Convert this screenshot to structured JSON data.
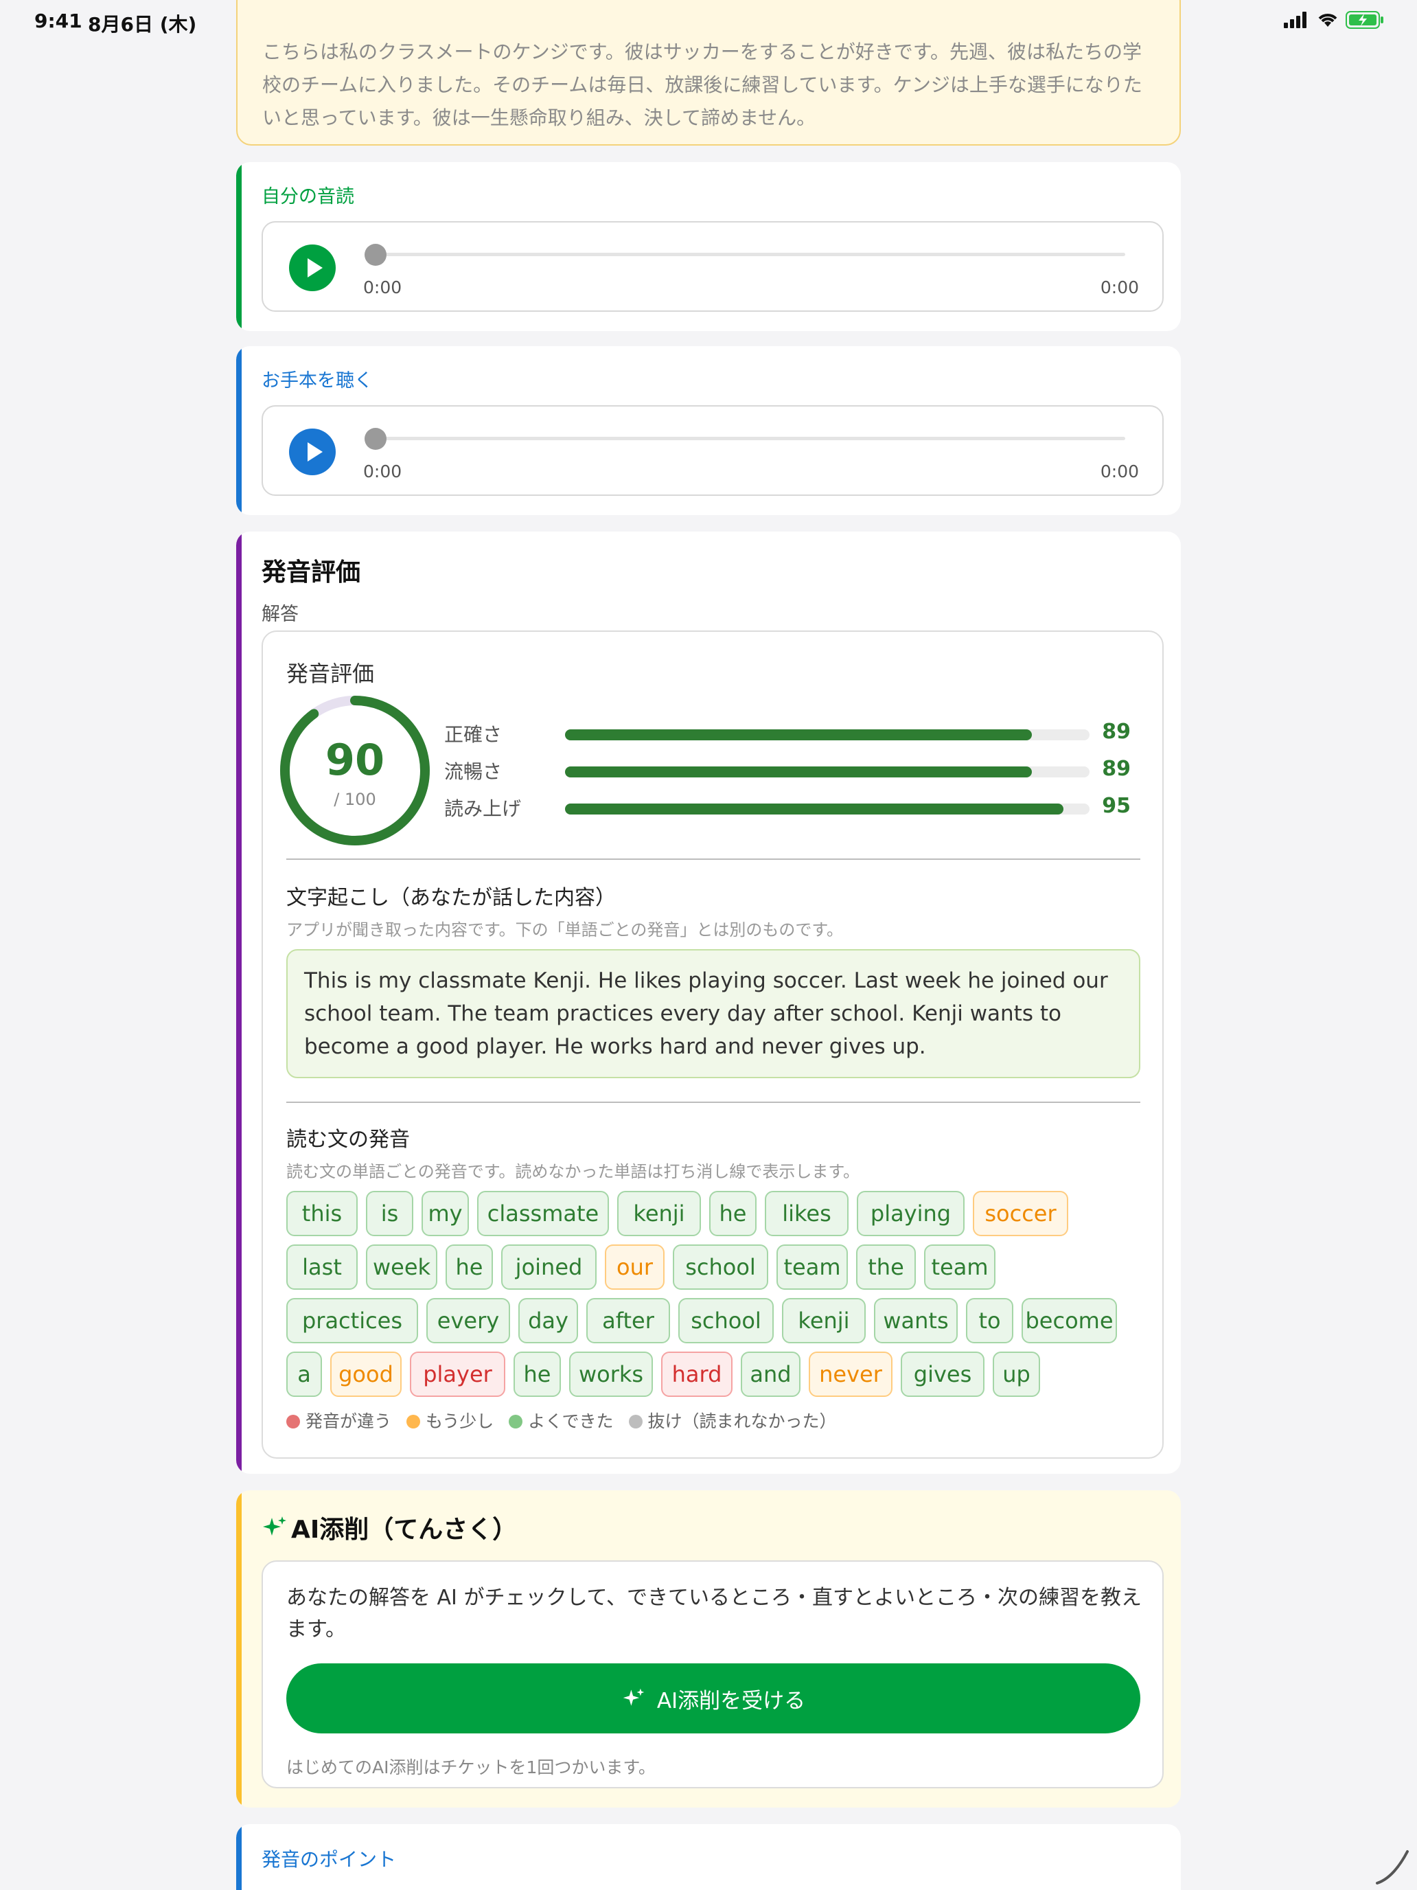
{
  "status_bar": {
    "time": "9:41",
    "date": "8月6日 (木)"
  },
  "passage": {
    "text": "こちらは私のクラスメートのケンジです。彼はサッカーをすることが好きです。先週、彼は私たちの学校のチームに入りました。そのチームは毎日、放課後に練習しています。ケンジは上手な選手になりたいと思っています。彼は一生懸命取り組み、決して諦めません。"
  },
  "own_reading": {
    "label": "自分の音読",
    "current": "0:00",
    "duration": "0:00",
    "color": "#00a040"
  },
  "model_reading": {
    "label": "お手本を聴く",
    "current": "0:00",
    "duration": "0:00",
    "color": "#1976d2"
  },
  "evaluation": {
    "title": "発音評価",
    "subtitle": "解答",
    "inner_title": "発音評価",
    "score": "90",
    "score_max": "/ 100",
    "score_value": 90,
    "metrics": [
      {
        "name": "正確さ",
        "value": "89",
        "percent": 89
      },
      {
        "name": "流暢さ",
        "value": "89",
        "percent": 89
      },
      {
        "name": "読み上げ",
        "value": "95",
        "percent": 95
      }
    ],
    "transcript_title": "文字起こし（あなたが話した内容）",
    "transcript_note": "アプリが聞き取った内容です。下の「単語ごとの発音」とは別のものです。",
    "transcript": "This is my classmate Kenji. He likes playing soccer. Last week he joined our school team. The team practices every day after school. Kenji wants to become a good player. He works hard and never gives up.",
    "words_title": "読む文の発音",
    "words_note": "読む文の単語ごとの発音です。読めなかった単語は打ち消し線で表示します。",
    "words": [
      {
        "w": "this",
        "s": "good"
      },
      {
        "w": "is",
        "s": "good"
      },
      {
        "w": "my",
        "s": "good"
      },
      {
        "w": "classmate",
        "s": "good"
      },
      {
        "w": "kenji",
        "s": "good"
      },
      {
        "w": "he",
        "s": "good"
      },
      {
        "w": "likes",
        "s": "good"
      },
      {
        "w": "playing",
        "s": "good"
      },
      {
        "w": "soccer",
        "s": "warn"
      },
      {
        "w": "last",
        "s": "good"
      },
      {
        "w": "week",
        "s": "good"
      },
      {
        "w": "he",
        "s": "good"
      },
      {
        "w": "joined",
        "s": "good"
      },
      {
        "w": "our",
        "s": "warn"
      },
      {
        "w": "school",
        "s": "good"
      },
      {
        "w": "team",
        "s": "good"
      },
      {
        "w": "the",
        "s": "good"
      },
      {
        "w": "team",
        "s": "good"
      },
      {
        "w": "practices",
        "s": "good"
      },
      {
        "w": "every",
        "s": "good"
      },
      {
        "w": "day",
        "s": "good"
      },
      {
        "w": "after",
        "s": "good"
      },
      {
        "w": "school",
        "s": "good"
      },
      {
        "w": "kenji",
        "s": "good"
      },
      {
        "w": "wants",
        "s": "good"
      },
      {
        "w": "to",
        "s": "good"
      },
      {
        "w": "become",
        "s": "good"
      },
      {
        "w": "a",
        "s": "good"
      },
      {
        "w": "good",
        "s": "warn"
      },
      {
        "w": "player",
        "s": "bad"
      },
      {
        "w": "he",
        "s": "good"
      },
      {
        "w": "works",
        "s": "good"
      },
      {
        "w": "hard",
        "s": "bad"
      },
      {
        "w": "and",
        "s": "good"
      },
      {
        "w": "never",
        "s": "warn"
      },
      {
        "w": "gives",
        "s": "good"
      },
      {
        "w": "up",
        "s": "good"
      }
    ],
    "legend": [
      {
        "label": "発音が違う",
        "color": "#e57373"
      },
      {
        "label": "もう少し",
        "color": "#ffb74d"
      },
      {
        "label": "よくできた",
        "color": "#81c784"
      },
      {
        "label": "抜け（読まれなかった）",
        "color": "#bdbdbd"
      }
    ]
  },
  "ai_review": {
    "title": "AI添削（てんさく）",
    "description": "あなたの解答を AI がチェックして、できているところ・直すとよいところ・次の練習を教えます。",
    "button_label": "AI添削を受ける",
    "note": "はじめてのAI添削はチケットを1回つかいます。"
  },
  "tips": {
    "label": "発音のポイント"
  }
}
